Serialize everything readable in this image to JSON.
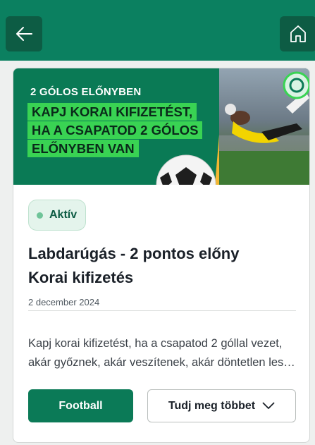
{
  "nav": {
    "back_icon": "arrow-left-icon",
    "home_icon": "home-icon"
  },
  "banner": {
    "eyebrow": "2 GÓLOS ELŐNYBEN",
    "headline_lines": [
      "KAPJ KORAI KIFIZETÉST,",
      "HA A CSAPATOD 2 GÓLOS",
      "ELŐNYBEN VAN"
    ]
  },
  "promo": {
    "status": "Aktív",
    "title_line1": "Labdarúgás - 2 pontos előny",
    "title_line2": "Korai kifizetés",
    "date": "2 december 2024",
    "description": "Kapj korai kifizetést, ha a csapatod 2 góllal vezet, akár győznek, akár veszítenek, akár döntetlen lesz a meccs.",
    "primary_button": "Football",
    "secondary_button": "Tudj meg többet"
  },
  "colors": {
    "brand_green": "#0b8060",
    "dark_green": "#0d5c44",
    "highlight_green": "#39d353"
  }
}
